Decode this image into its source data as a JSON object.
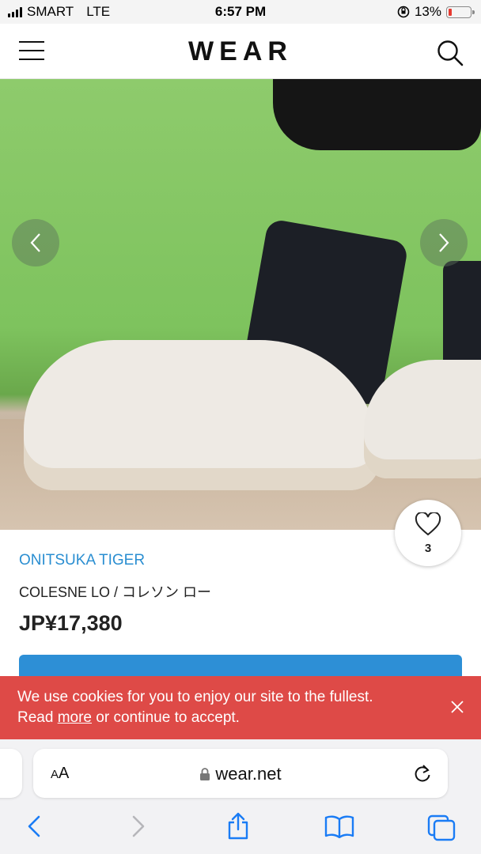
{
  "status_bar": {
    "carrier": "SMART",
    "network": "LTE",
    "time": "6:57 PM",
    "battery": "13%",
    "battery_level": 0.13
  },
  "header": {
    "logo": "WEAR"
  },
  "product": {
    "favorite_count": "3",
    "brand": "ONITSUKA TIGER",
    "name": "COLESNE LO / コレソン ロー",
    "price": "JP¥17,380"
  },
  "cookie_banner": {
    "line1": "We use cookies for you to enjoy our site to the fullest.",
    "prefix": "Read ",
    "link": "more",
    "suffix": " or continue to accept."
  },
  "browser": {
    "aa_small": "A",
    "aa_large": "A",
    "url": "wear.net"
  },
  "colors": {
    "brand_link": "#2a8ed1",
    "cta": "#2d8fd6",
    "cookie_bg": "#de4a47",
    "ios_blue": "#1a7cf5"
  },
  "icons": [
    "hamburger-icon",
    "search-icon",
    "chevron-left-icon",
    "chevron-right-icon",
    "heart-icon",
    "close-icon",
    "lock-icon",
    "reload-icon",
    "back-icon",
    "forward-icon",
    "share-icon",
    "bookmarks-icon",
    "tabs-icon"
  ]
}
